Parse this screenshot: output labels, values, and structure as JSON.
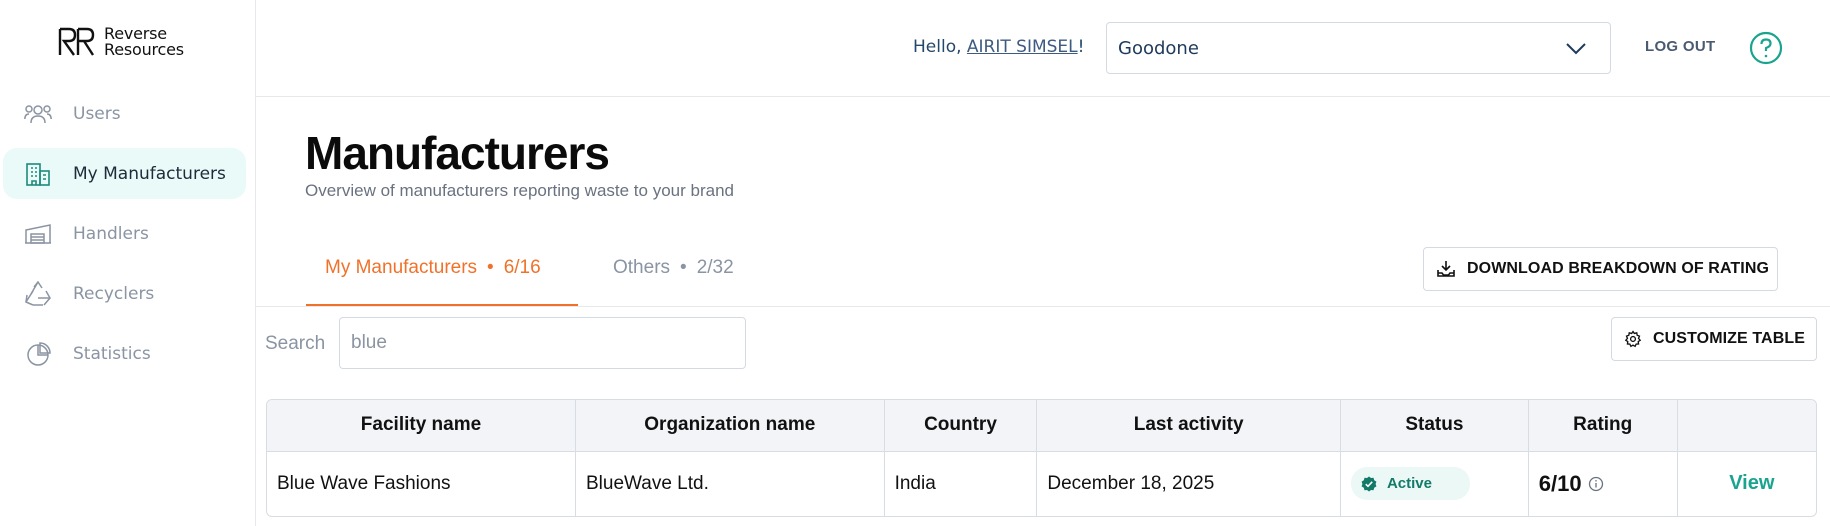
{
  "brand": {
    "line1": "Reverse",
    "line2": "Resources"
  },
  "sidebar": {
    "items": [
      {
        "label": "Users",
        "icon": "users-icon",
        "active": false
      },
      {
        "label": "My Manufacturers",
        "icon": "building-icon",
        "active": true
      },
      {
        "label": "Handlers",
        "icon": "warehouse-icon",
        "active": false
      },
      {
        "label": "Recyclers",
        "icon": "recycle-icon",
        "active": false
      },
      {
        "label": "Statistics",
        "icon": "pie-chart-icon",
        "active": false
      }
    ]
  },
  "header": {
    "greeting_prefix": "Hello, ",
    "user_name": "AIRIT SIMSEL",
    "greeting_suffix": "!",
    "org_select_value": "Goodone",
    "logout_label": "LOG OUT",
    "help_icon": "help-circle-icon"
  },
  "page": {
    "title": "Manufacturers",
    "subtitle": "Overview of manufacturers reporting waste to your brand"
  },
  "tabs": [
    {
      "label": "My Manufacturers",
      "dot": "•",
      "count": "6/16",
      "active": true
    },
    {
      "label": "Others",
      "dot": "•",
      "count": "2/32",
      "active": false
    }
  ],
  "actions": {
    "download_label": "DOWNLOAD BREAKDOWN OF RATING",
    "customize_label": "CUSTOMIZE TABLE"
  },
  "search": {
    "label": "Search",
    "value": "blue"
  },
  "table": {
    "columns": [
      "Facility name",
      "Organization name",
      "Country",
      "Last activity",
      "Status",
      "Rating",
      ""
    ],
    "rows": [
      {
        "facility": "Blue Wave Fashions",
        "organization": "BlueWave Ltd.",
        "country": "India",
        "last_activity": "December 18, 2025",
        "status": "Active",
        "rating": "6/10",
        "action": "View"
      }
    ]
  },
  "colors": {
    "accent_orange": "#f0722a",
    "accent_teal": "#1aa48f",
    "active_nav_bg": "#e9faf8"
  }
}
